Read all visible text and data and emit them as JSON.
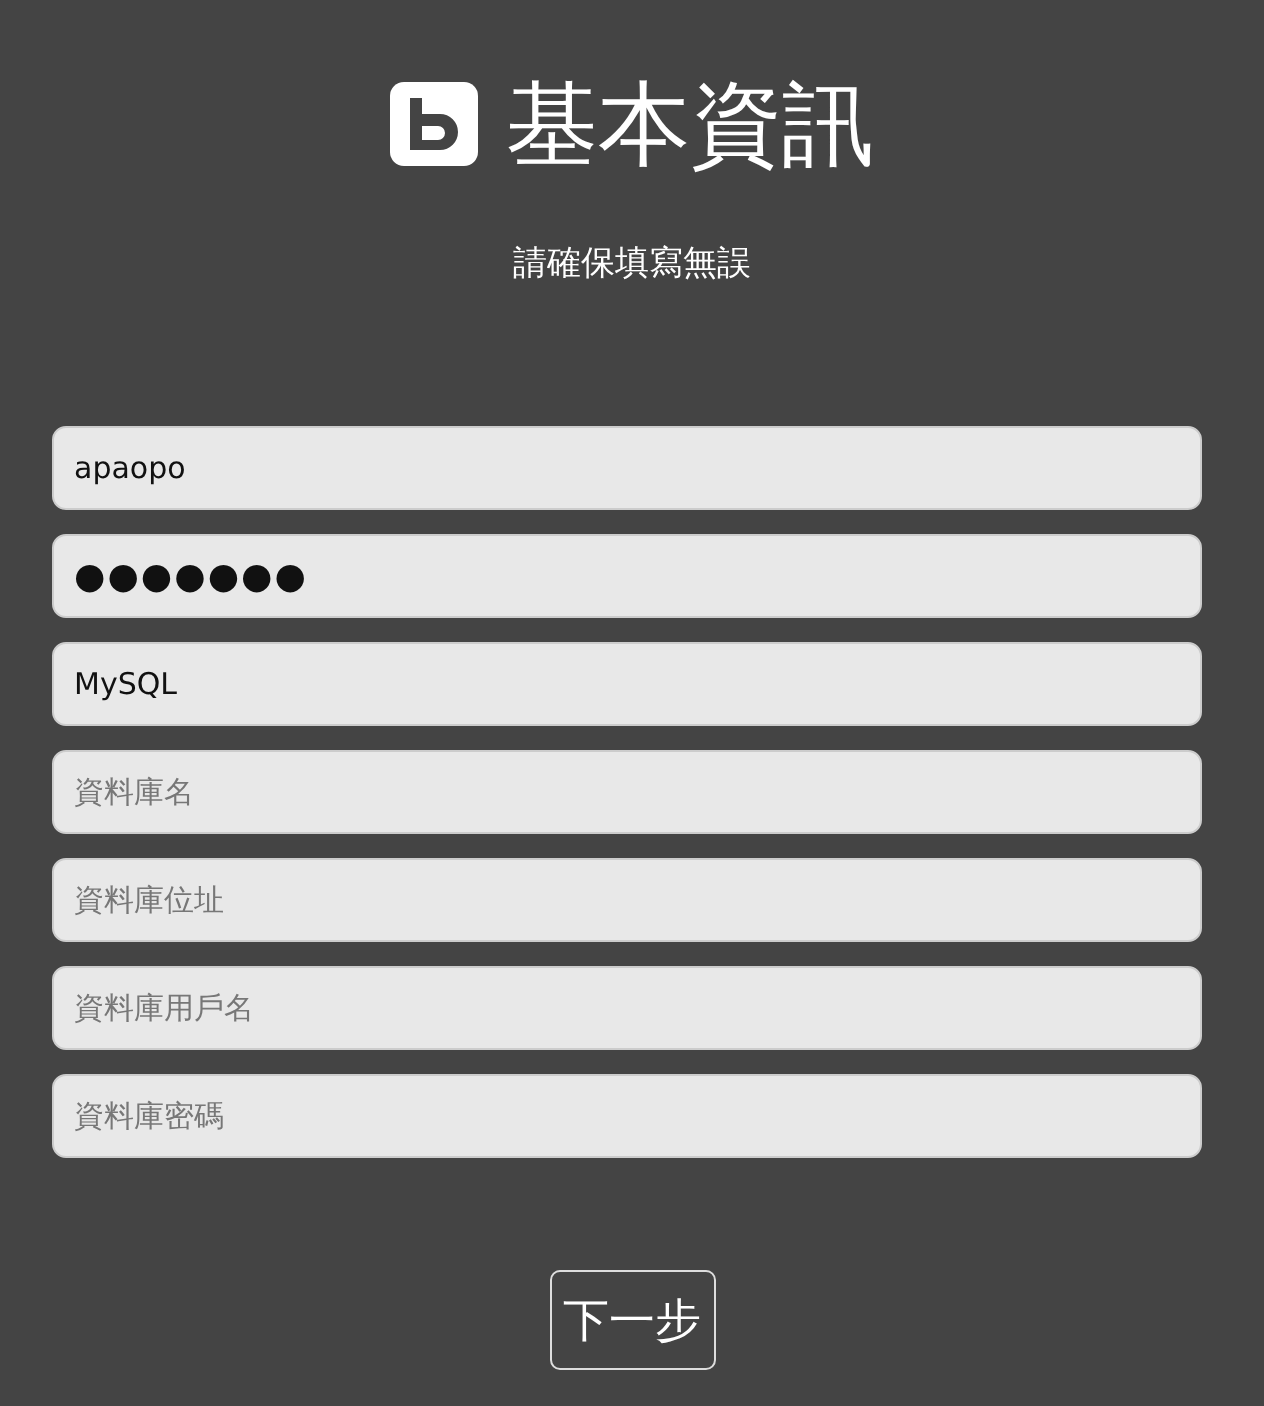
{
  "header": {
    "title": "基本資訊",
    "subtitle": "請確保填寫無誤"
  },
  "fields": [
    {
      "value": "apaopo"
    },
    {
      "value": "●●●●●●●"
    },
    {
      "value": "MySQL"
    },
    {
      "placeholder": "資料庫名"
    },
    {
      "placeholder": "資料庫位址"
    },
    {
      "placeholder": "資料庫用戶名"
    },
    {
      "placeholder": "資料庫密碼"
    }
  ],
  "button": "下一步"
}
